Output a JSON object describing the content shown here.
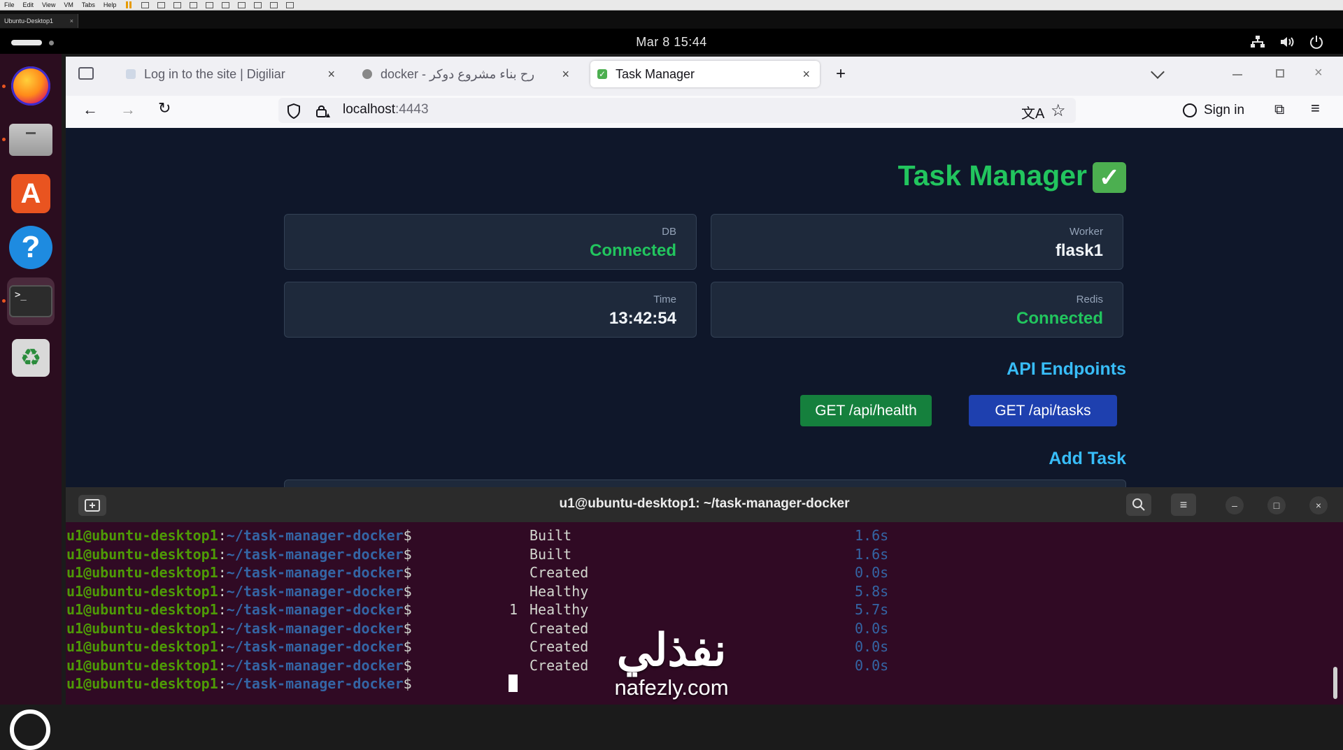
{
  "vm": {
    "menu": [
      "File",
      "Edit",
      "View",
      "VM",
      "Tabs",
      "Help"
    ],
    "tab_label": "Ubuntu-Desktop1",
    "tab_close": "×"
  },
  "topbar": {
    "clock": "Mar 8  15:44",
    "icons": [
      "network-icon",
      "volume-icon",
      "power-icon"
    ]
  },
  "dock": {
    "items": [
      "firefox",
      "files",
      "app-center",
      "help",
      "terminal",
      "trash"
    ],
    "terminal_glyph": ">_",
    "help_glyph": "?",
    "trash_glyph": "♻"
  },
  "browser": {
    "tabs": [
      {
        "label": "Log in to the site | Digiliar",
        "close": "×"
      },
      {
        "label": "docker - رح بناء مشروع دوكر",
        "close": "×"
      },
      {
        "label": "Task Manager",
        "close": "×"
      }
    ],
    "new_tab": "+",
    "url_host": "localhost",
    "url_port": ":4443",
    "sign_in": "Sign in"
  },
  "page": {
    "title": "Task Manager",
    "title_emoji": "✓",
    "cards": [
      {
        "label": "DB",
        "value": "Connected",
        "color": "#22c55e"
      },
      {
        "label": "Worker",
        "value": "flask1",
        "color": "#f1f5f9"
      },
      {
        "label": "Time",
        "value": "13:42:54",
        "color": "#f1f5f9"
      },
      {
        "label": "Redis",
        "value": "Connected",
        "color": "#22c55e"
      }
    ],
    "api_title": "API Endpoints",
    "buttons": [
      {
        "label": "GET /api/health",
        "color": "#15803d"
      },
      {
        "label": "GET /api/tasks",
        "color": "#1e40af"
      }
    ],
    "add_task_title": "Add Task"
  },
  "terminal": {
    "title": "u1@ubuntu-desktop1: ~/task-manager-docker",
    "prompt_user": "u1@ubuntu-desktop1",
    "prompt_colon": ":",
    "prompt_path": "~/task-manager-docker",
    "prompt_dollar": "$",
    "lines": [
      {
        "num": "",
        "status": "Built",
        "time": "1.6s"
      },
      {
        "num": "",
        "status": "Built",
        "time": "1.6s"
      },
      {
        "num": "",
        "status": "Created",
        "time": "0.0s"
      },
      {
        "num": "",
        "status": "Healthy",
        "time": "5.8s"
      },
      {
        "num": "1",
        "status": "Healthy",
        "time": "5.7s"
      },
      {
        "num": "",
        "status": "Created",
        "time": "0.0s"
      },
      {
        "num": "",
        "status": "Created",
        "time": "0.0s"
      },
      {
        "num": "",
        "status": "Created",
        "time": "0.0s"
      }
    ]
  },
  "watermark": {
    "logo": "نفذلي",
    "url": "nafezly.com"
  }
}
